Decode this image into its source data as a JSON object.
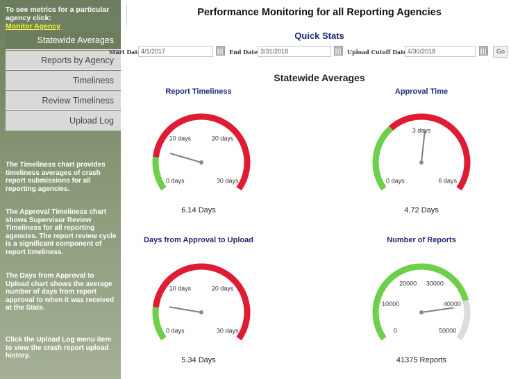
{
  "sidebar": {
    "intro_text": "To see metrics for a particular agency click:",
    "intro_link": "Monitor Agency",
    "menu": [
      "Statewide Averages",
      "Reports by Agency",
      "Timeliness",
      "Review Timeliness",
      "Upload Log"
    ],
    "active_index": 0,
    "paragraphs": [
      "The Timeliness chart provides timeliness averages of crash report submissions for all reporting agencies.",
      "The Approval Timeliness chart shows Supervisor Review Timeliness for all reporting agencies. The report review cycle is a significant component of report timeliness.",
      "The Days from Approval to Upload chart shows the average number of days from report approval to when it was received at the State.",
      "Click the Upload Log menu item to view the crash report upload history."
    ]
  },
  "header": {
    "title": "Performance Monitoring for all Reporting Agencies"
  },
  "quick_stats": {
    "title": "Quick Stats",
    "start_label": "Start Date",
    "start_value": "4/1/2017",
    "end_label": "End Date",
    "end_value": "3/31/2018",
    "cutoff_label": "Upload Cutoff Date",
    "cutoff_value": "4/30/2018",
    "go_label": "Go"
  },
  "section_title": "Statewide Averages",
  "colors": {
    "good": "#6ecf4a",
    "bad": "#e01b34",
    "neutral": "#dcdcdc",
    "title_blue": "#1f2a78"
  },
  "gauges": [
    {
      "title": "Report Timeliness",
      "value_text": "6.14 Days",
      "value": 6.14,
      "min": 0,
      "max": 30,
      "labels": [
        "0 days",
        "10 days",
        "20 days",
        "30 days"
      ],
      "bands": [
        {
          "from": 0,
          "to": 5,
          "color": "good"
        },
        {
          "from": 5,
          "to": 30,
          "color": "bad"
        }
      ]
    },
    {
      "title": "Approval Time",
      "value_text": "4.72 Days",
      "value": 4.72,
      "min": 0,
      "max": 9,
      "labels": [
        "0 days",
        "3 days",
        "6 days"
      ],
      "bands": [
        {
          "from": 0,
          "to": 3,
          "color": "good"
        },
        {
          "from": 3,
          "to": 9,
          "color": "bad"
        }
      ]
    },
    {
      "title": "Days from Approval to Upload",
      "value_text": "5.34 Days",
      "value": 5.34,
      "min": 0,
      "max": 30,
      "labels": [
        "0 days",
        "10 days",
        "20 days",
        "30 days"
      ],
      "bands": [
        {
          "from": 0,
          "to": 5,
          "color": "good"
        },
        {
          "from": 5,
          "to": 30,
          "color": "bad"
        }
      ]
    },
    {
      "title": "Number of Reports",
      "value_text": "41375 Reports",
      "value": 41375,
      "min": 0,
      "max": 50000,
      "labels": [
        "0",
        "10000",
        "20000",
        "30000",
        "40000",
        "50000"
      ],
      "bands": [
        {
          "from": 0,
          "to": 40000,
          "color": "good"
        },
        {
          "from": 40000,
          "to": 50000,
          "color": "neutral"
        }
      ]
    }
  ]
}
